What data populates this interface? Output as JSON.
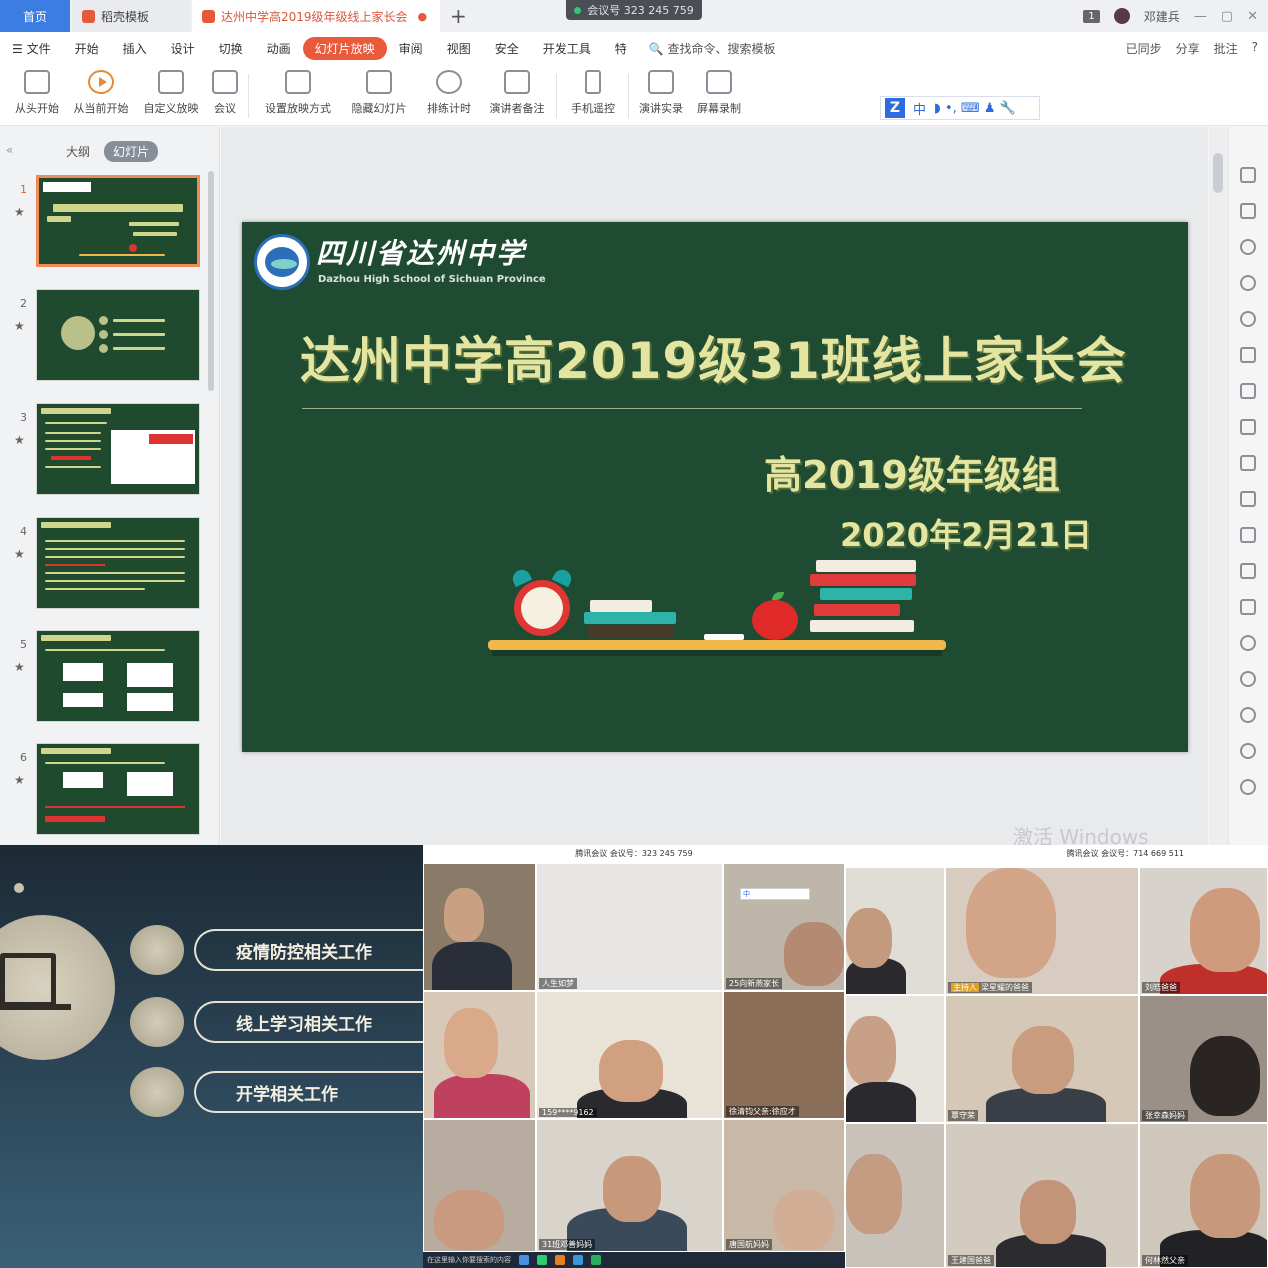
{
  "window": {
    "tabs": [
      {
        "label": "首页"
      },
      {
        "label": "稻壳模板"
      },
      {
        "label": "达州中学高2019级年级线上家长会"
      }
    ],
    "meeting_id": "会议号 323 245 759",
    "page_badge": "1",
    "user_name": "邓建兵",
    "minimize": "—",
    "restore": "▢",
    "close": "✕"
  },
  "menu": {
    "file": "☰ 文件",
    "items": [
      "开始",
      "插入",
      "设计",
      "切换",
      "动画",
      "幻灯片放映",
      "审阅",
      "视图",
      "安全",
      "开发工具",
      "特"
    ],
    "active": "幻灯片放映",
    "search": "🔍 查找命令、搜索模板",
    "sync": "已同步",
    "share": "分享",
    "comment": "批注",
    "help": "?"
  },
  "ribbon": {
    "buttons": [
      "从头开始",
      "从当前开始",
      "自定义放映",
      "会议",
      "设置放映方式",
      "隐藏幻灯片",
      "排练计时",
      "演讲者备注",
      "手机遥控",
      "演讲实录",
      "屏幕录制"
    ]
  },
  "ime": {
    "logo": "Z",
    "mode": "中",
    "extra": "◗ •, ⌨ ♟ 🔧"
  },
  "panel": {
    "collapse": "«",
    "outline": "大纲",
    "slides": "幻灯片",
    "thumbs": [
      "1",
      "2",
      "3",
      "4",
      "5",
      "6"
    ]
  },
  "slide": {
    "school_cn": "四川省达州中学",
    "school_en": "Dazhou High School of Sichuan Province",
    "title": "达州中学高2019级31班线上家长会",
    "subtitle": "高2019级年级组",
    "date": "2020年2月21日"
  },
  "watermark": "激活 Windows",
  "photo": {
    "items": [
      "疫情防控相关工作",
      "线上学习相关工作",
      "开学相关工作"
    ]
  },
  "grid1": {
    "header": "腾讯会议 会议号：323 245 759",
    "names": [
      "人生如梦",
      "25向新燕家长",
      "159****9162",
      "徐清钧父亲:徐应才",
      "31班邓善妈妈",
      "唐国航妈妈"
    ]
  },
  "grid2": {
    "header": "腾讯会议 会议号：714 669 511",
    "speaking": "主持人",
    "names": [
      "梁星耀的爸爸",
      "刘皓爸爸",
      "覃守荣",
      "张幸森妈妈",
      "王建国爸爸",
      "何林然父亲"
    ]
  },
  "taskbar": {
    "search": "在这里输入你要搜索的内容"
  }
}
